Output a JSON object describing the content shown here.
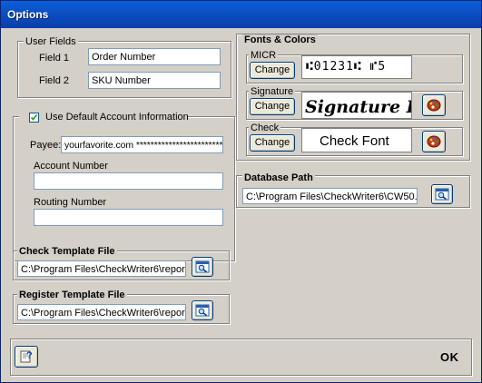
{
  "window": {
    "title": "Options"
  },
  "user_fields": {
    "legend": "User Fields",
    "field1_label": "Field 1",
    "field1_value": "Order Number",
    "field2_label": "Field 2",
    "field2_value": "SKU Number"
  },
  "account": {
    "checkbox_checked": true,
    "checkbox_label": "Use Default Account Information",
    "payee_label": "Payee:",
    "payee_value": "yourfavorite.com ************************",
    "account_number_label": "Account Number",
    "account_number_value": "",
    "routing_number_label": "Routing Number",
    "routing_number_value": ""
  },
  "check_template": {
    "legend": "Check Template File",
    "path": "C:\\Program Files\\CheckWriter6\\repor"
  },
  "register_template": {
    "legend": "Register Template File",
    "path": "C:\\Program Files\\CheckWriter6\\repor"
  },
  "fonts_colors": {
    "legend": "Fonts & Colors",
    "micr_label": "MICR",
    "micr_sample": "⑆01231⑆ ⑈5",
    "signature_label": "Signature",
    "signature_sample": "Signature F",
    "check_label": "Check",
    "check_sample": "Check Font",
    "change_label": "Change"
  },
  "database": {
    "legend": "Database Path",
    "path": "C:\\Program Files\\CheckWriter6\\CW50."
  },
  "footer": {
    "ok_label": "OK"
  },
  "icons": {
    "browse": "folder-search-icon",
    "color": "color-palette-icon",
    "help": "help-icon"
  }
}
